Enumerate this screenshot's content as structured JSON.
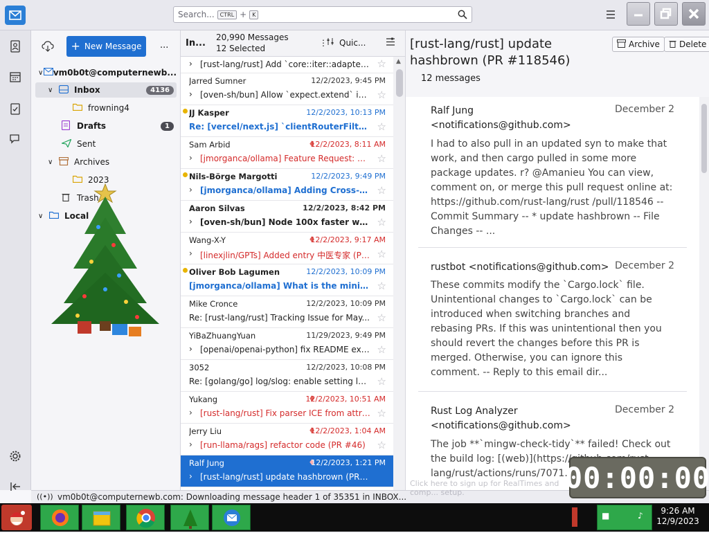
{
  "search": {
    "placeholder": "Search...",
    "key1": "CTRL",
    "plus": "+",
    "key2": "K"
  },
  "folder_pane": {
    "new_message_label": "New Message",
    "more_label": "...",
    "account": "vm0b0t@computernewb...",
    "folders": [
      {
        "label": "Inbox",
        "count": "4136"
      },
      {
        "label": "frowning4"
      },
      {
        "label": "Drafts",
        "count": "1"
      },
      {
        "label": "Sent"
      },
      {
        "label": "Archives"
      },
      {
        "label": "2023"
      },
      {
        "label": "Trash"
      },
      {
        "label": "Local"
      }
    ]
  },
  "list": {
    "header_label": "In...",
    "total": "20,990 Messages",
    "selected": "12 Selected",
    "quick_filter": "Quic...",
    "rows": [
      {
        "from": "",
        "date": "",
        "subject": "[rust-lang/rust] Add `core::iter::adapters::..."
      },
      {
        "from": "Jarred Sumner",
        "date": "12/2/2023, 9:45 PM",
        "subject": "[oven-sh/bun] Allow `expect.extend` in p..."
      },
      {
        "from": "JJ Kasper",
        "date": "12/2/2023, 10:13 PM",
        "subject": "Re: [vercel/next.js] `clientRouterFilter` c..."
      },
      {
        "from": "Sam Arbid",
        "date": "12/2/2023, 8:11 AM",
        "subject": "[jmorganca/ollama] Feature Request: 🛠 C..."
      },
      {
        "from": "Nils-Börge Margotti",
        "date": "12/2/2023, 9:49 PM",
        "subject": "[jmorganca/ollama] Adding Cross-Or..."
      },
      {
        "from": "Aaron Silvas",
        "date": "12/2/2023, 8:42 PM",
        "subject": "[oven-sh/bun] Node 100x faster writi..."
      },
      {
        "from": "Wang-X-Y",
        "date": "12/2/2023, 9:17 AM",
        "subject": "[linexjlin/GPTs] Added entry 中医专家 (PR ..."
      },
      {
        "from": "Oliver Bob Lagumen",
        "date": "12/2/2023, 10:09 PM",
        "subject": "[jmorganca/ollama] What is the minim..."
      },
      {
        "from": "Mike Cronce",
        "date": "12/2/2023, 10:09 PM",
        "subject": "Re: [rust-lang/rust] Tracking Issue for May..."
      },
      {
        "from": "YiBaZhuangYuan",
        "date": "11/29/2023, 9:49 PM",
        "subject": "[openai/openai-python] fix README exa..."
      },
      {
        "from": "3052",
        "date": "12/2/2023, 10:08 PM",
        "subject": "Re: [golang/go] log/slog: enable setting le..."
      },
      {
        "from": "Yukang",
        "date": "12/2/2023, 10:51 AM",
        "subject": "[rust-lang/rust] Fix parser ICE from attrs (..."
      },
      {
        "from": "Jerry Liu",
        "date": "12/2/2023, 1:04 AM",
        "subject": "[run-llama/rags] refactor code (PR #46)"
      },
      {
        "from": "Ralf Jung",
        "date": "12/2/2023, 1:21 PM",
        "subject": "[rust-lang/rust] update hashbrown (PR #1..."
      }
    ]
  },
  "reader": {
    "title": "[rust-lang/rust] update hashbrown (PR #118546)",
    "count": "12 messages",
    "archive_label": "Archive",
    "delete_label": "Delete",
    "messages": [
      {
        "who": "Ralf Jung <notifications@github.com>",
        "date": "December 2",
        "body": "I had to also pull in an updated syn to make that work, and then cargo pulled in some more package updates. r? @Amanieu You can view, comment on, or merge this pull request online at: https://github.com/rust-lang/rust /pull/118546 -- Commit Summary -- * update hashbrown -- File Changes -- ..."
      },
      {
        "who": "rustbot <notifications@github.com>",
        "date": "December 2",
        "body": "These commits modify the `Cargo.lock` file. Unintentional changes to `Cargo.lock` can be introduced when switching branches and rebasing PRs. If this was unintentional then you should revert the changes before this PR is merged. Otherwise, you can ignore this comment. -- Reply to this email dir..."
      },
      {
        "who": "Rust Log Analyzer <notifications@github.com>",
        "date": "December 2",
        "body": "The job **`mingw-check-tidy`** failed! Check out the build log: [(web)](https://github.com/rust-lang/rust/actions/runs/7071..."
      }
    ]
  },
  "status": {
    "text": "vm0b0t@computernewb.com: Downloading message header 1 of 35351 in INBOX..."
  },
  "overlay": {
    "timer": "00:00:00",
    "toast": "Click here to sign up for RealTimes and comp... setup."
  },
  "taskbar": {
    "time": "9:26 AM",
    "date": "12/9/2023"
  },
  "colors": {
    "accent": "#1f6fd1",
    "unread_red": "#d42a2a",
    "taskbar_green": "#2ea84a"
  }
}
